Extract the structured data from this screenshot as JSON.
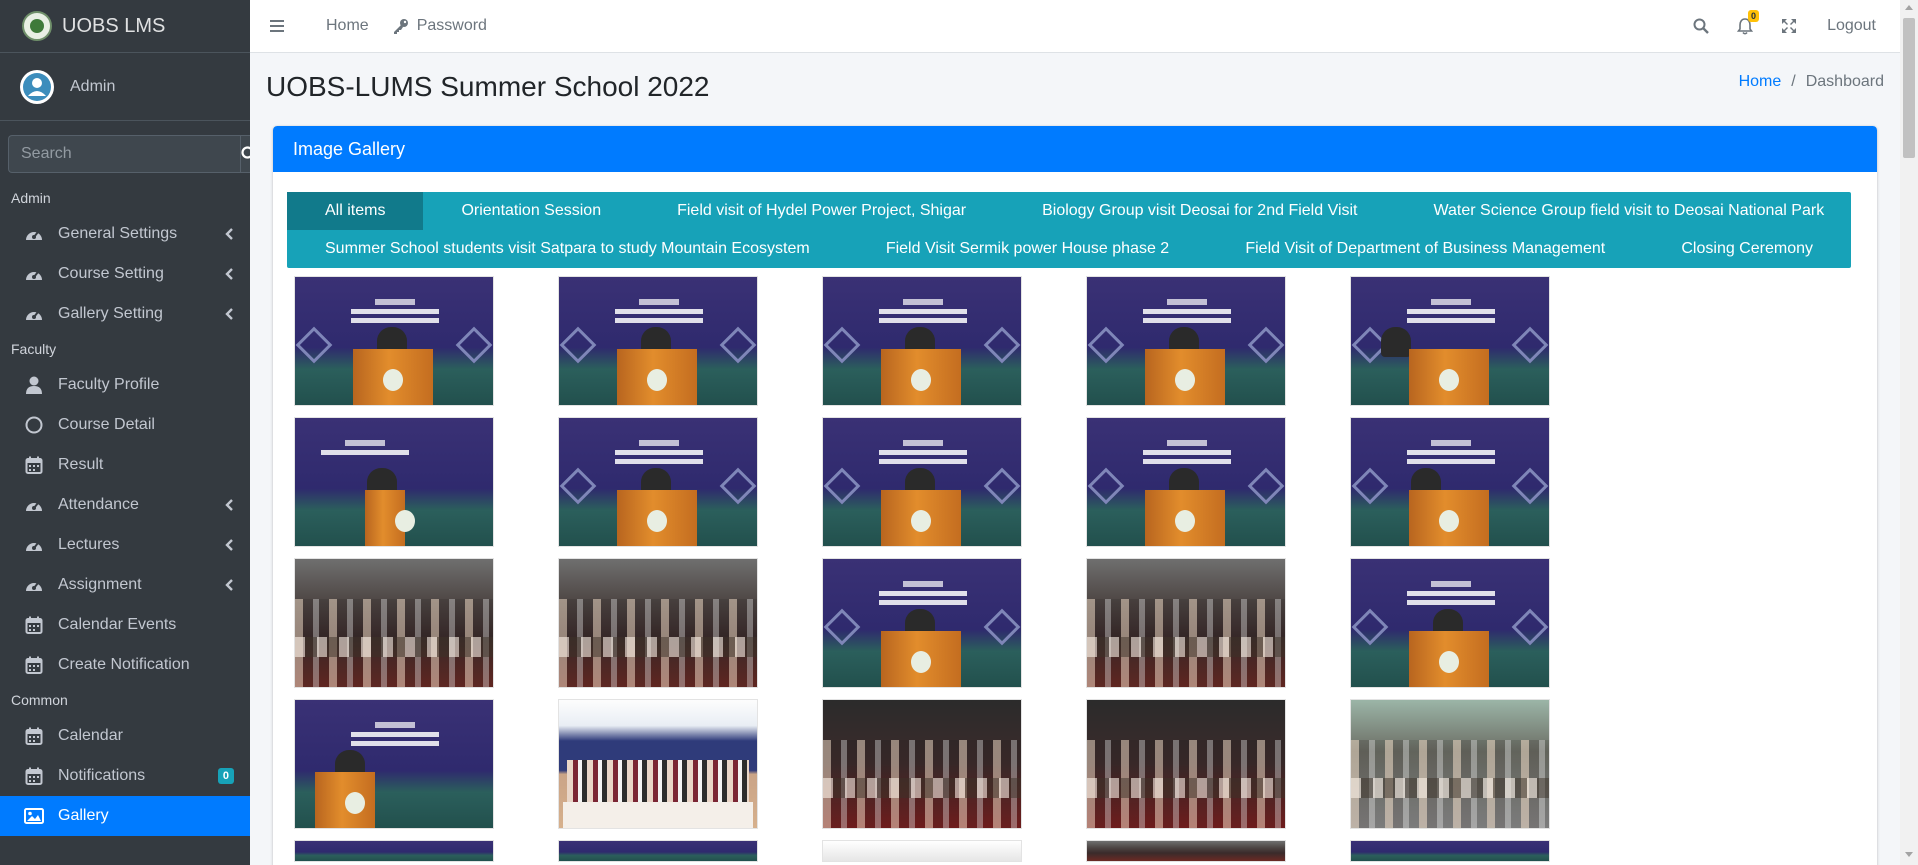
{
  "brand": {
    "name": "UOBS LMS"
  },
  "user": {
    "name": "Admin"
  },
  "sidebar_search": {
    "placeholder": "Search"
  },
  "sidebar": {
    "sections": {
      "admin": "Admin",
      "faculty": "Faculty",
      "common": "Common"
    },
    "admin_items": [
      {
        "label": "General Settings",
        "icon": "dashboard-gauge-icon",
        "has_submenu": true
      },
      {
        "label": "Course Setting",
        "icon": "dashboard-gauge-icon",
        "has_submenu": true
      },
      {
        "label": "Gallery Setting",
        "icon": "dashboard-gauge-icon",
        "has_submenu": true
      }
    ],
    "faculty_items": [
      {
        "label": "Faculty Profile",
        "icon": "user-icon"
      },
      {
        "label": "Course Detail",
        "icon": "circle-icon"
      },
      {
        "label": "Result",
        "icon": "calendar-icon"
      },
      {
        "label": "Attendance",
        "icon": "dashboard-gauge-icon",
        "has_submenu": true
      },
      {
        "label": "Lectures",
        "icon": "dashboard-gauge-icon",
        "has_submenu": true
      },
      {
        "label": "Assignment",
        "icon": "dashboard-gauge-icon",
        "has_submenu": true
      },
      {
        "label": "Calendar Events",
        "icon": "calendar-icon"
      },
      {
        "label": "Create Notification",
        "icon": "calendar-icon"
      }
    ],
    "common_items": [
      {
        "label": "Calendar",
        "icon": "calendar-icon"
      },
      {
        "label": "Notifications",
        "icon": "calendar-icon",
        "badge": "0"
      },
      {
        "label": "Gallery",
        "icon": "image-icon",
        "active": true
      }
    ]
  },
  "topbar": {
    "home": "Home",
    "password": "Password",
    "notification_count": "0",
    "logout": "Logout"
  },
  "page": {
    "title": "UOBS-LUMS Summer School 2022",
    "breadcrumb": {
      "home": "Home",
      "current": "Dashboard"
    }
  },
  "gallery": {
    "card_title": "Image Gallery",
    "filters_row1": [
      "All items",
      "Orientation Session",
      "Field visit of Hydel Power Project, Shigar",
      "Biology Group visit Deosai for 2nd Field Visit",
      "Water Science Group field visit to Deosai National Park"
    ],
    "filters_row2": [
      "Summer School students visit Satpara to study Mountain Ecosystem",
      "Field Visit Sermik power House phase 2",
      "Field Visit of Department of Business Management",
      "Closing Ceremony"
    ],
    "active_filter": "All items"
  },
  "colors": {
    "sidebar_bg": "#343a40",
    "primary": "#007bff",
    "filter_bar": "#17a2b8",
    "filter_active": "#117a8b",
    "notif_badge": "#ffc107"
  }
}
